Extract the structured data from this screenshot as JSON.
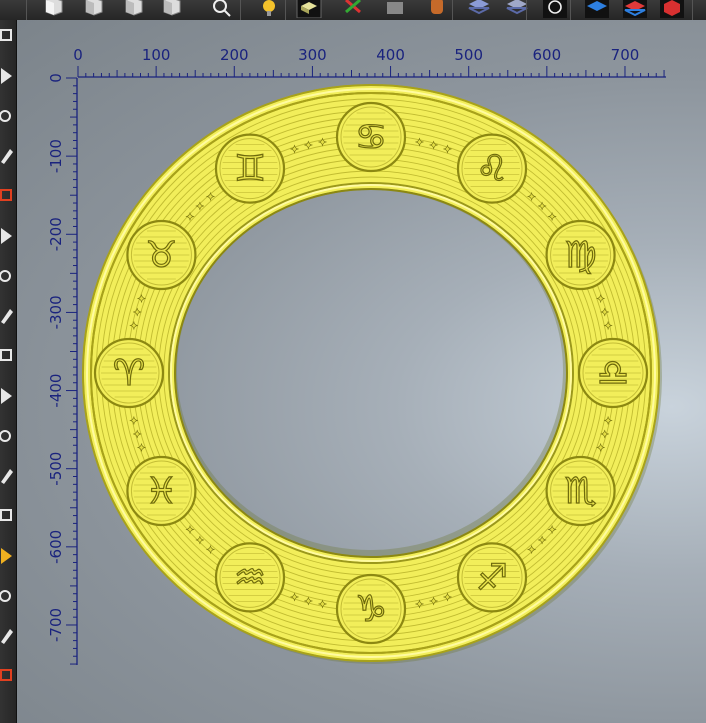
{
  "toolbar": {
    "buttons": [
      {
        "name": "view-front-icon"
      },
      {
        "name": "view-back-icon"
      },
      {
        "name": "view-right-icon"
      },
      {
        "name": "view-left-icon"
      },
      {
        "name": "zoom-icon"
      },
      {
        "name": "lighting-icon"
      },
      {
        "name": "relief-shaded-icon"
      },
      {
        "name": "relief-edit-icon"
      },
      {
        "name": "model-icon"
      },
      {
        "name": "material-icon"
      },
      {
        "name": "layer-stack-icon"
      },
      {
        "name": "layer-flat-icon"
      },
      {
        "name": "reset-view-icon"
      },
      {
        "name": "blue-layer-icon"
      },
      {
        "name": "red-layer-icon"
      },
      {
        "name": "red-box-icon"
      }
    ]
  },
  "left_tools": [
    {
      "name": "select-tool-icon"
    },
    {
      "name": "pointer-tool-icon"
    },
    {
      "name": "curve-tool-icon"
    },
    {
      "name": "transform-tool-icon"
    },
    {
      "name": "pen-tool-icon"
    },
    {
      "name": "eraser-tool-icon"
    },
    {
      "name": "corner-tool-icon"
    },
    {
      "name": "move-tool-icon"
    },
    {
      "name": "rectangle-tool-icon"
    },
    {
      "name": "circle-tool-icon"
    },
    {
      "name": "star-tool-icon"
    },
    {
      "name": "arc-tool-icon"
    },
    {
      "name": "polyline-tool-icon"
    },
    {
      "name": "fill-tool-icon"
    },
    {
      "name": "shield-tool-icon"
    },
    {
      "name": "brush-tool-icon"
    },
    {
      "name": "pencil-tool-icon"
    }
  ],
  "ruler": {
    "x_labels": [
      "0",
      "100",
      "200",
      "300",
      "400",
      "500",
      "600",
      "700"
    ],
    "y_labels": [
      "0",
      "-100",
      "-200",
      "-300",
      "-400",
      "-500",
      "-600",
      "-700"
    ]
  },
  "ring": {
    "color": "#f2ee5a",
    "shadow_color": "#8a8a10",
    "zodiac_signs": [
      "♋",
      "♌",
      "♍",
      "♎",
      "♏",
      "♐",
      "♑",
      "♒",
      "♓",
      "♈",
      "♉",
      "♊"
    ]
  }
}
